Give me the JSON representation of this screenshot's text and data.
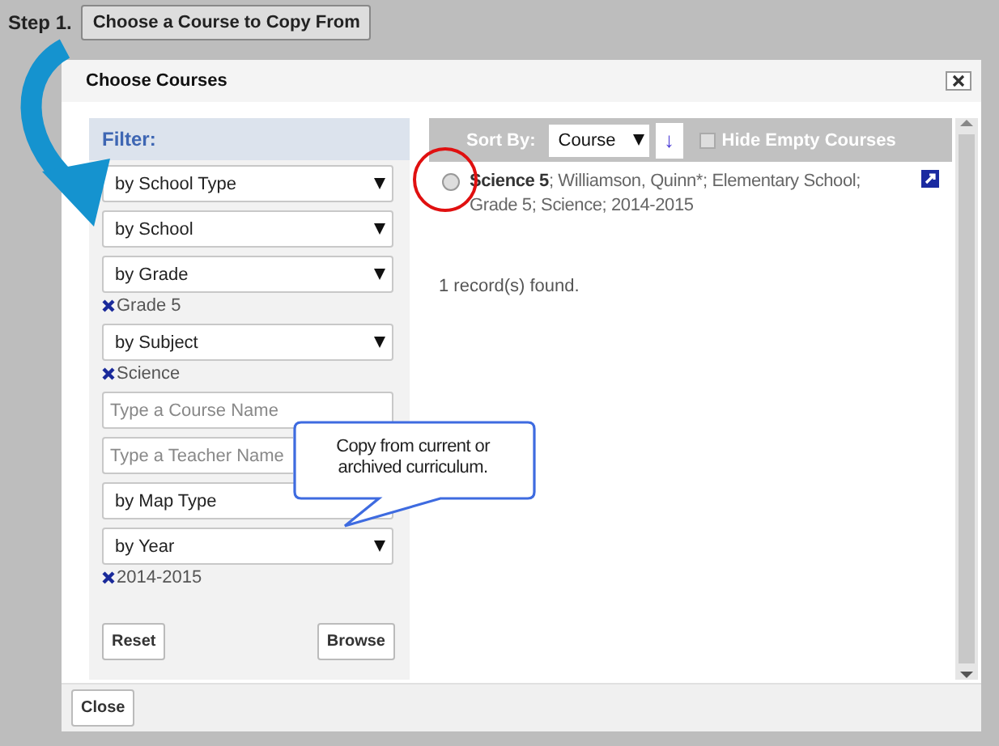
{
  "step": {
    "label": "Step 1.",
    "button": "Choose a Course to Copy From"
  },
  "dialog": {
    "title": "Choose Courses",
    "filter": {
      "title": "Filter:",
      "controls": [
        {
          "kind": "select",
          "label": "by School Type"
        },
        {
          "kind": "select",
          "label": "by School"
        },
        {
          "kind": "select",
          "label": "by Grade",
          "chip": "Grade 5"
        },
        {
          "kind": "select",
          "label": "by Subject",
          "chip": "Science"
        },
        {
          "kind": "input",
          "placeholder": "Type a Course Name"
        },
        {
          "kind": "input",
          "placeholder": "Type a Teacher Name"
        },
        {
          "kind": "select",
          "label": "by Map Type"
        },
        {
          "kind": "select",
          "label": "by Year",
          "chip": "2014-2015"
        }
      ],
      "buttons": [
        "Reset",
        "Browse"
      ]
    },
    "sort": {
      "label": "Sort By:",
      "value": "Course",
      "direction": "↓",
      "hide_empty": {
        "label": "Hide Empty Courses",
        "checked": false
      }
    },
    "results": [
      {
        "title": "Science 5",
        "details": "; Williamson, Quinn*; Elementary School; Grade 5; Science; 2014-2015",
        "selected": false
      }
    ],
    "count": "1 record(s) found.",
    "close": "Close"
  },
  "callout": {
    "text": "Copy from current or archived curriculum."
  }
}
